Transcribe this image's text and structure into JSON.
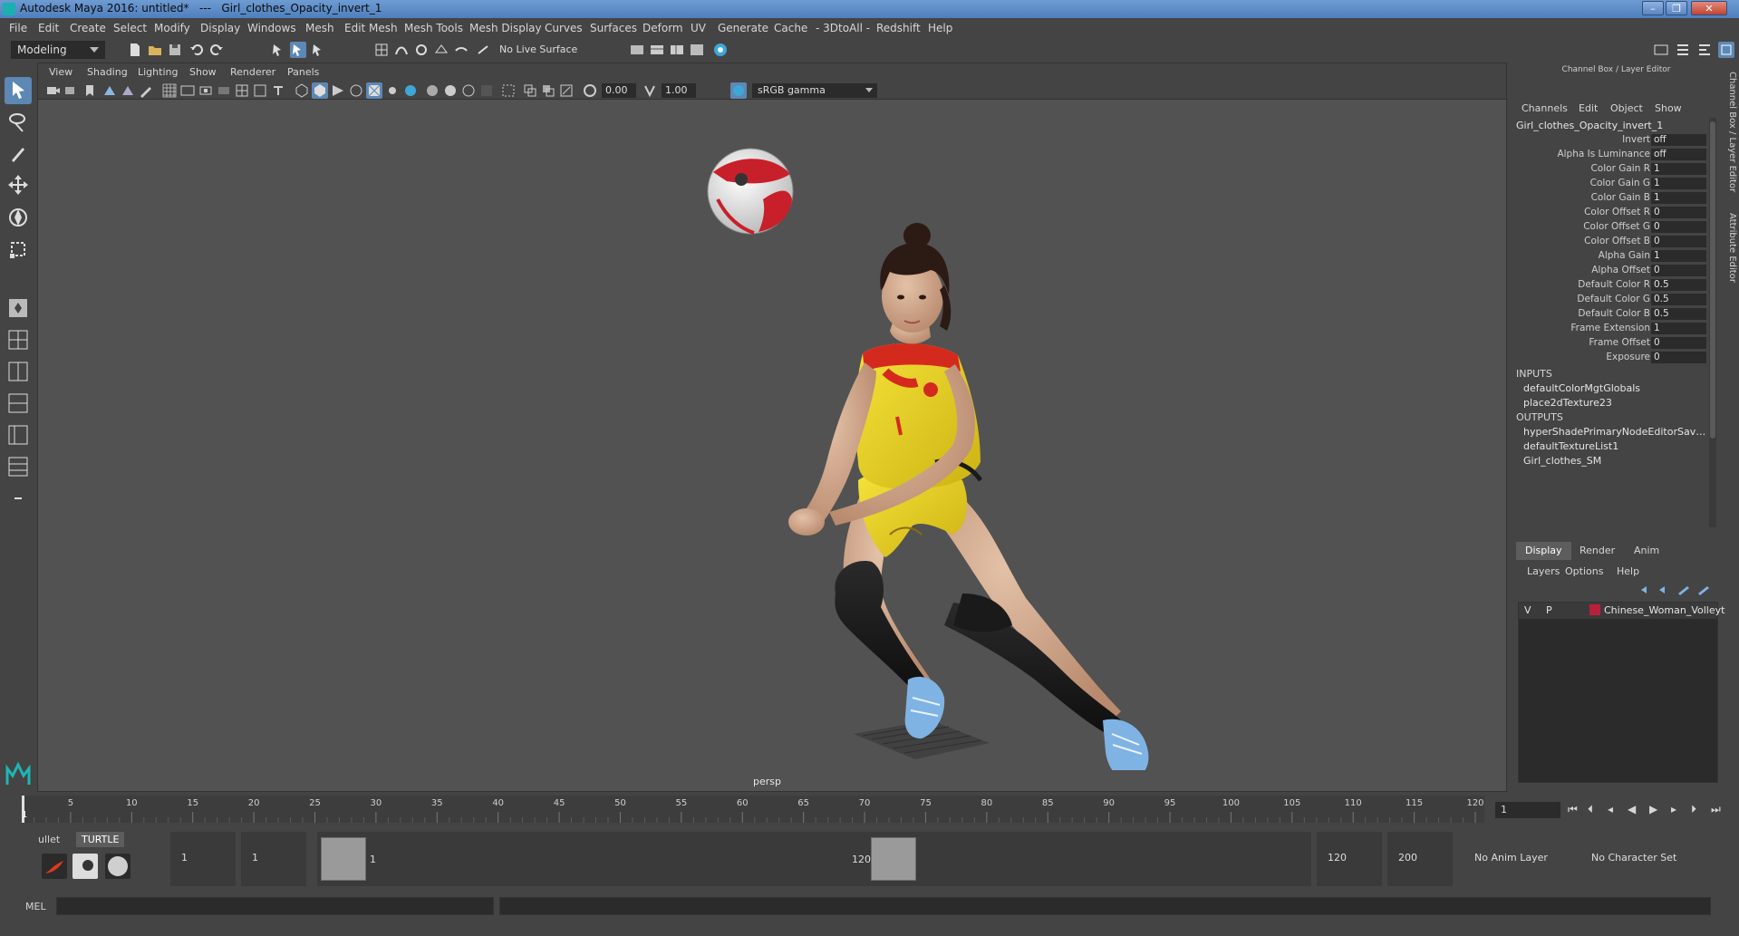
{
  "window": {
    "title": "Autodesk Maya 2016: untitled*   ---   Girl_clothes_Opacity_invert_1"
  },
  "menubar": [
    "File",
    "Edit",
    "Create",
    "Select",
    "Modify",
    "Display",
    "Windows",
    "Mesh",
    "Edit Mesh",
    "Mesh Tools",
    "Mesh Display",
    "Curves",
    "Surfaces",
    "Deform",
    "UV",
    "Generate",
    "Cache",
    "- 3DtoAll -",
    "Redshift",
    "Help"
  ],
  "statusline": {
    "mode": "Modeling",
    "live_surface": "No Live Surface"
  },
  "viewport": {
    "menu": [
      "View",
      "Shading",
      "Lighting",
      "Show",
      "Renderer",
      "Panels"
    ],
    "exposure": "0.00",
    "gamma": "1.00",
    "color_space": "sRGB gamma",
    "camera_label": "persp"
  },
  "channel_box": {
    "header": "Channel Box / Layer Editor",
    "menu": [
      "Channels",
      "Edit",
      "Object",
      "Show"
    ],
    "node_name": "Girl_clothes_Opacity_invert_1",
    "attributes": [
      {
        "label": "Invert",
        "value": "off"
      },
      {
        "label": "Alpha Is Luminance",
        "value": "off"
      },
      {
        "label": "Color Gain R",
        "value": "1"
      },
      {
        "label": "Color Gain G",
        "value": "1"
      },
      {
        "label": "Color Gain B",
        "value": "1"
      },
      {
        "label": "Color Offset R",
        "value": "0"
      },
      {
        "label": "Color Offset G",
        "value": "0"
      },
      {
        "label": "Color Offset B",
        "value": "0"
      },
      {
        "label": "Alpha Gain",
        "value": "1"
      },
      {
        "label": "Alpha Offset",
        "value": "0"
      },
      {
        "label": "Default Color R",
        "value": "0.5"
      },
      {
        "label": "Default Color G",
        "value": "0.5"
      },
      {
        "label": "Default Color B",
        "value": "0.5"
      },
      {
        "label": "Frame Extension",
        "value": "1"
      },
      {
        "label": "Frame Offset",
        "value": "0"
      },
      {
        "label": "Exposure",
        "value": "0"
      }
    ],
    "inputs_label": "INPUTS",
    "inputs": [
      "defaultColorMgtGlobals",
      "place2dTexture23"
    ],
    "outputs_label": "OUTPUTS",
    "outputs": [
      "hyperShadePrimaryNodeEditorSave...",
      "defaultTextureList1",
      "Girl_clothes_SM"
    ]
  },
  "layer_editor": {
    "tabs": [
      "Display",
      "Render",
      "Anim"
    ],
    "menu": [
      "Layers",
      "Options",
      "Help"
    ],
    "layer": {
      "v": "V",
      "p": "P",
      "name": "Chinese_Woman_Volleyt",
      "color": "#b8203a"
    }
  },
  "side_tabs": [
    "Channel Box / Layer Editor",
    "Attribute Editor"
  ],
  "timeline": {
    "ticks": [
      "5",
      "10",
      "15",
      "20",
      "25",
      "30",
      "35",
      "40",
      "45",
      "50",
      "55",
      "60",
      "65",
      "70",
      "75",
      "80",
      "85",
      "90",
      "95",
      "100",
      "105",
      "110",
      "115",
      "120"
    ],
    "current_frame": "1",
    "current_frame_field": "1"
  },
  "range": {
    "shelf_tabs": [
      "ullet",
      "TURTLE"
    ],
    "start": "1",
    "playback_start": "1",
    "range_start": "1",
    "range_end": "120",
    "playback_end": "120",
    "end": "200",
    "anim_layer": "No Anim Layer",
    "character_set": "No Character Set"
  },
  "command_line": {
    "label": "MEL"
  },
  "colors": {
    "accent": "#5d88b5",
    "background": "#444444",
    "viewport": "#525252"
  }
}
